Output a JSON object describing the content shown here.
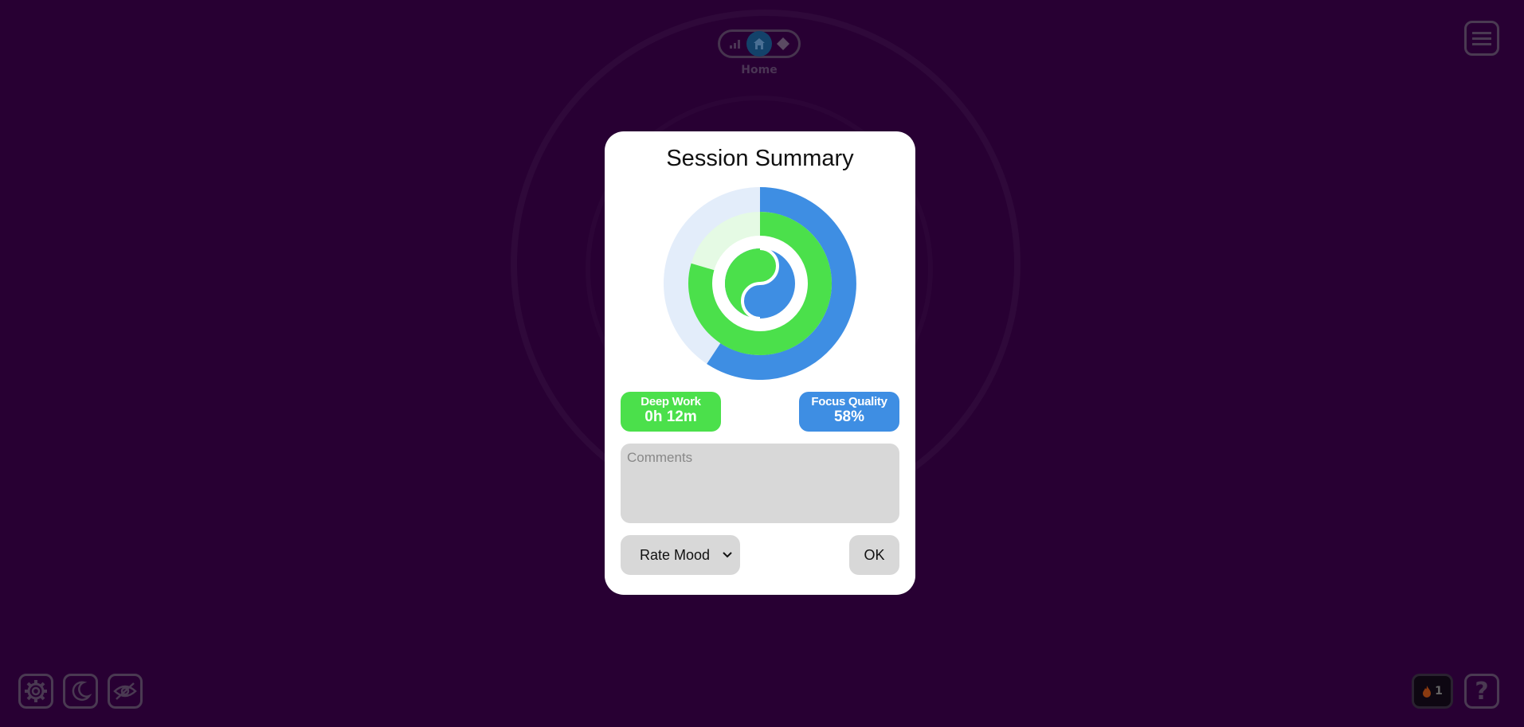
{
  "header": {
    "mode_label": "Home",
    "mode_icons": [
      "signal-bars-icon",
      "home-icon",
      "diamond-icon"
    ]
  },
  "modal": {
    "title": "Session Summary",
    "deep_work": {
      "label": "Deep Work",
      "value": "0h 12m"
    },
    "focus_quality": {
      "label": "Focus Quality",
      "value": "58%"
    },
    "comments_placeholder": "Comments",
    "mood_select": {
      "selected": "Rate Mood"
    },
    "ok_label": "OK"
  },
  "streak": {
    "count": "1"
  },
  "colors": {
    "background": "#280033",
    "deep_work_green": "#4be04b",
    "focus_blue": "#3e8ee3",
    "light_blue": "#e3edfa",
    "light_green": "#e5fae4"
  }
}
